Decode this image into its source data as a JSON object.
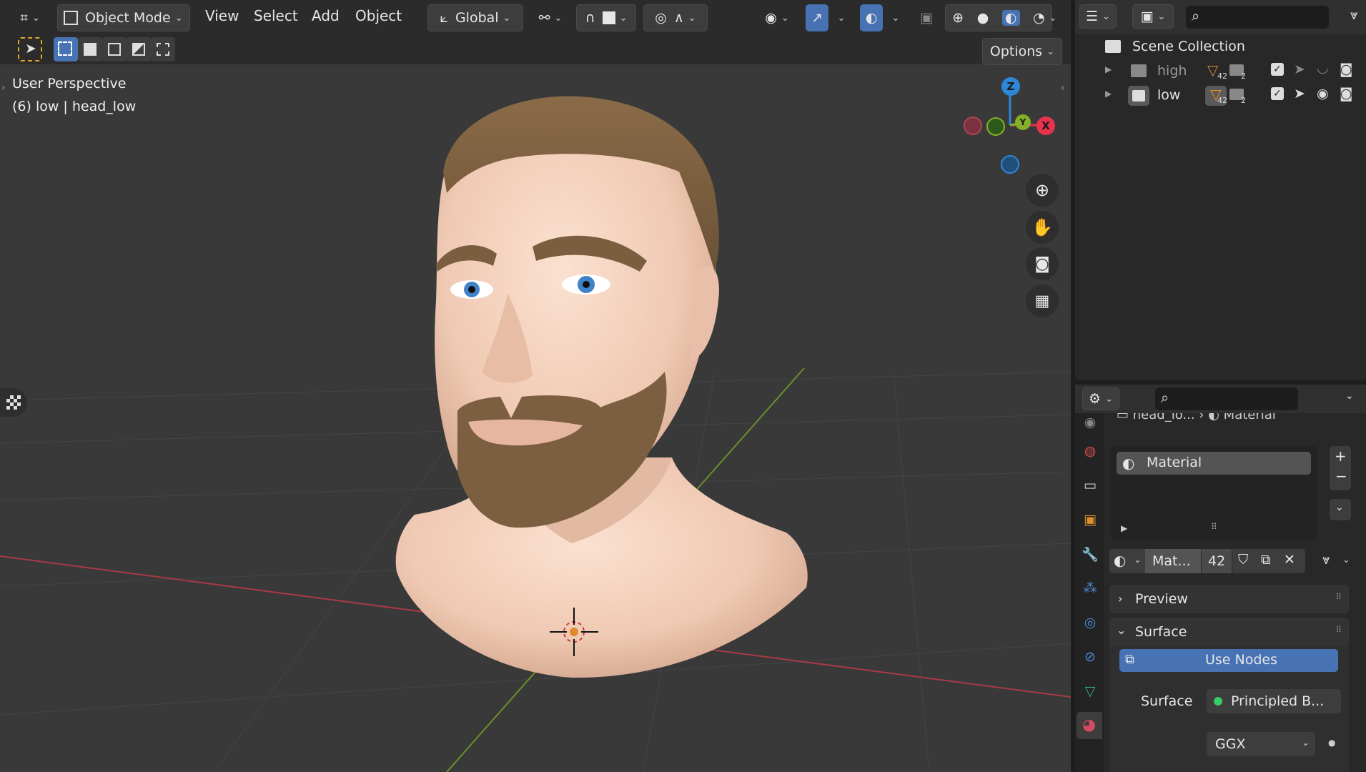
{
  "header": {
    "mode": "Object Mode",
    "menus": [
      "View",
      "Select",
      "Add",
      "Object"
    ],
    "transform_orientation": "Global",
    "options_label": "Options"
  },
  "overlay": {
    "view_name": "User Perspective",
    "object_info": "(6) low | head_low"
  },
  "gizmo": {
    "z": "Z",
    "y": "Y",
    "x": "X"
  },
  "outliner": {
    "root": "Scene Collection",
    "collections": [
      {
        "name": "high",
        "badge_mesh": "42",
        "badge_coll": "2"
      },
      {
        "name": "low",
        "badge_mesh": "42",
        "badge_coll": "2"
      }
    ]
  },
  "properties": {
    "breadcrumb_object": "head_lo...",
    "breadcrumb_tab": "Material",
    "slot_name": "Material",
    "material_name": "Mat...",
    "users": "42",
    "panels": {
      "preview": "Preview",
      "surface": "Surface"
    },
    "use_nodes": "Use Nodes",
    "surface_label": "Surface",
    "surface_value": "Principled B...",
    "distribution": "GGX"
  },
  "colors": {
    "accent": "#4772b3",
    "axis_x": "#e8334e",
    "axis_y": "#84b027",
    "axis_z": "#2e86d6",
    "node_socket": "#33cc66"
  }
}
